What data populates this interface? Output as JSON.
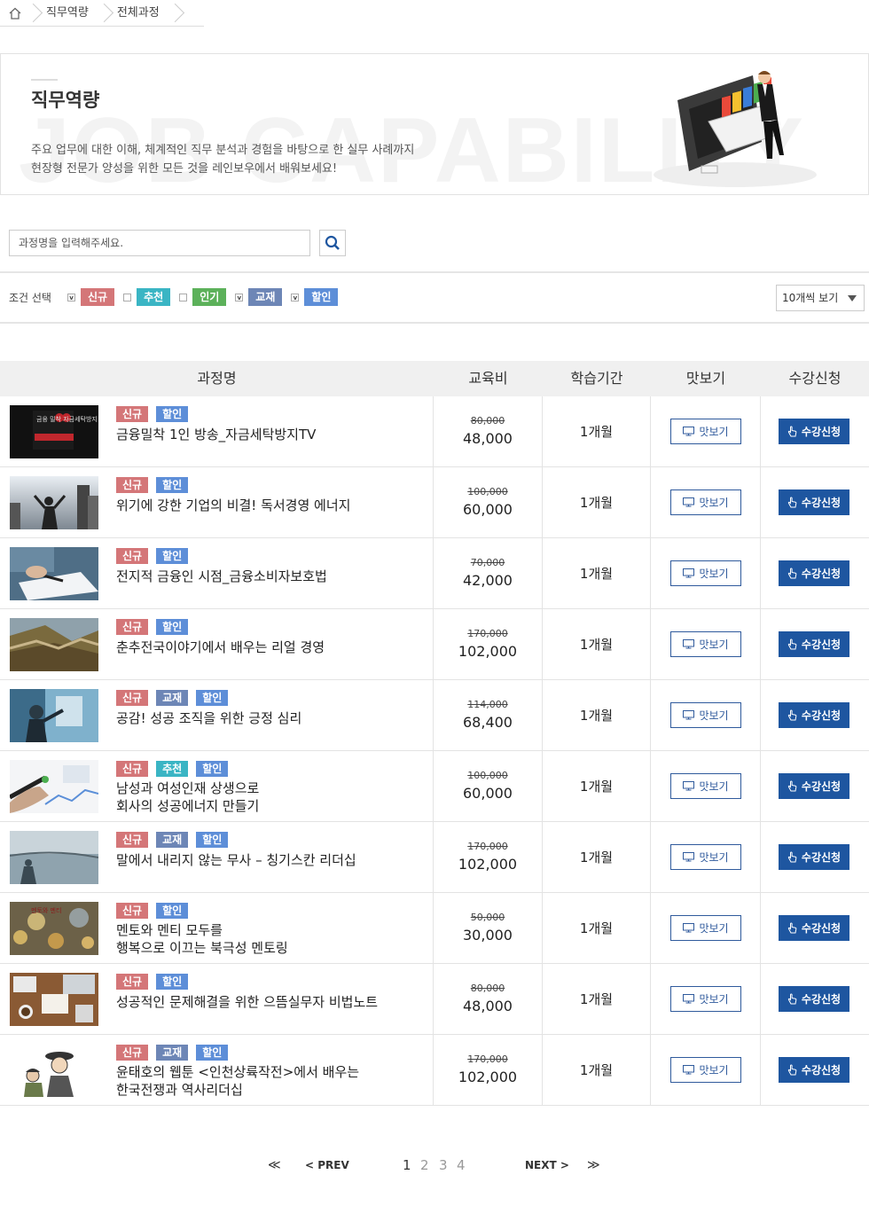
{
  "breadcrumb": {
    "items": [
      "직무역량",
      "전체과정"
    ]
  },
  "hero": {
    "title": "직무역량",
    "bg_text": "JOB CAPABILITY",
    "desc_line1": "주요 업무에 대한 이해, 체계적인 직무 분석과 경험을 바탕으로 한 실무 사례까지",
    "desc_line2": "현장형 전문가 양성을 위한 모든 것을 레인보우에서 배워보세요!"
  },
  "search": {
    "placeholder": "과정명을 입력해주세요.",
    "icon": "search-icon"
  },
  "filter": {
    "label": "조건 선택",
    "options": [
      {
        "label": "신규",
        "checked": true,
        "color": "#d47678"
      },
      {
        "label": "추천",
        "checked": false,
        "color": "#3ab5c4"
      },
      {
        "label": "인기",
        "checked": false,
        "color": "#5cb15a"
      },
      {
        "label": "교재",
        "checked": true,
        "color": "#6d86b6"
      },
      {
        "label": "할인",
        "checked": true,
        "color": "#5d8ed8"
      }
    ],
    "per_page": "10개씩 보기"
  },
  "table": {
    "headers": [
      "과정명",
      "교육비",
      "학습기간",
      "맛보기",
      "수강신청"
    ],
    "preview_label": "맛보기",
    "enroll_label": "수강신청",
    "rows": [
      {
        "tags": [
          "신규",
          "할인"
        ],
        "title": "금융밀착 1인 방송_자금세탁방지TV",
        "orig": "80,000",
        "price": "48,000",
        "period": "1개월",
        "thumb": "finance-broadcast-thumbnail",
        "thumb_text": "금융 밀착 자금세탁방지"
      },
      {
        "tags": [
          "신규",
          "할인"
        ],
        "title": "위기에 강한 기업의 비결! 독서경영 에너지",
        "orig": "100,000",
        "price": "60,000",
        "period": "1개월",
        "thumb": "city-person-thumbnail"
      },
      {
        "tags": [
          "신규",
          "할인"
        ],
        "title": "전지적 금융인 시점_금융소비자보호법",
        "orig": "70,000",
        "price": "42,000",
        "period": "1개월",
        "thumb": "signing-document-thumbnail"
      },
      {
        "tags": [
          "신규",
          "할인"
        ],
        "title": "춘추전국이야기에서 배우는 리얼 경영",
        "orig": "170,000",
        "price": "102,000",
        "period": "1개월",
        "thumb": "great-wall-thumbnail"
      },
      {
        "tags": [
          "신규",
          "교재",
          "할인"
        ],
        "title": "공감! 성공 조직을 위한 긍정 심리",
        "orig": "114,000",
        "price": "68,400",
        "period": "1개월",
        "thumb": "people-pointing-thumbnail"
      },
      {
        "tags": [
          "신규",
          "추천",
          "할인"
        ],
        "title": "남성과 여성인재 상생으로\n회사의 성공에너지 만들기",
        "orig": "100,000",
        "price": "60,000",
        "period": "1개월",
        "thumb": "chart-pen-thumbnail"
      },
      {
        "tags": [
          "신규",
          "교재",
          "할인"
        ],
        "title": "말에서 내리지 않는 무사 – 칭기스칸 리더십",
        "orig": "170,000",
        "price": "102,000",
        "period": "1개월",
        "thumb": "lake-rider-thumbnail"
      },
      {
        "tags": [
          "신규",
          "할인"
        ],
        "title": "멘토와 멘티 모두를\n행복으로 이끄는 북극성 멘토링",
        "orig": "50,000",
        "price": "30,000",
        "period": "1개월",
        "thumb": "bokeh-lights-thumbnail",
        "thumb_text": "멘토와 멘티"
      },
      {
        "tags": [
          "신규",
          "할인"
        ],
        "title": "성공적인 문제해결을 위한 으뜸실무자 비법노트",
        "orig": "80,000",
        "price": "48,000",
        "period": "1개월",
        "thumb": "office-desk-thumbnail"
      },
      {
        "tags": [
          "신규",
          "교재",
          "할인"
        ],
        "title": "윤태호의 웹툰 <인천상륙작전>에서 배우는\n한국전쟁과 역사리더십",
        "orig": "170,000",
        "price": "102,000",
        "period": "1개월",
        "thumb": "webtoon-characters-thumbnail"
      }
    ]
  },
  "pagination": {
    "first": "≪",
    "prev": "< PREV",
    "pages": [
      "1",
      "2",
      "3",
      "4"
    ],
    "current": "1",
    "next": "NEXT >",
    "last": "≫"
  }
}
